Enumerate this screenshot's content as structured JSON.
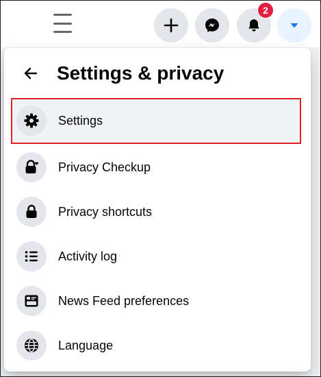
{
  "topbar": {
    "icons": {
      "menu": "hamburger-menu-icon",
      "create": "plus-icon",
      "messenger": "messenger-icon",
      "notifications": "bell-icon",
      "account": "caret-down-icon"
    },
    "notification_count": "2"
  },
  "panel": {
    "title": "Settings & privacy",
    "back_icon": "arrow-left-icon",
    "items": [
      {
        "label": "Settings",
        "icon": "gear-icon",
        "selected": true
      },
      {
        "label": "Privacy Checkup",
        "icon": "lock-heart-icon"
      },
      {
        "label": "Privacy shortcuts",
        "icon": "lock-icon"
      },
      {
        "label": "Activity log",
        "icon": "list-icon"
      },
      {
        "label": "News Feed preferences",
        "icon": "feed-icon"
      },
      {
        "label": "Language",
        "icon": "globe-icon"
      }
    ]
  },
  "colors": {
    "badge": "#e41e3f",
    "account_button": "#e7f3ff",
    "account_caret": "#1877f2",
    "highlight_border": "#e02020"
  }
}
